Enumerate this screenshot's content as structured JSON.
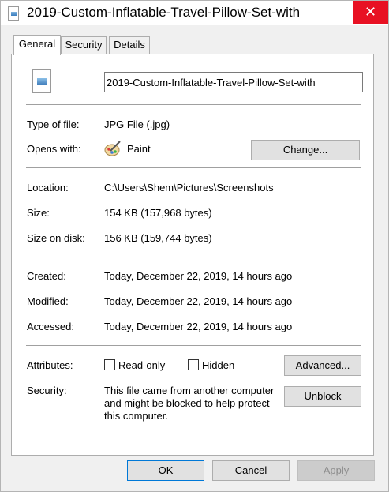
{
  "window": {
    "title": "2019-Custom-Inflatable-Travel-Pillow-Set-with",
    "close_glyph": "✕"
  },
  "tabs": [
    {
      "label": "General",
      "active": true
    },
    {
      "label": "Security",
      "active": false
    },
    {
      "label": "Details",
      "active": false
    }
  ],
  "general": {
    "file_name": "2019-Custom-Inflatable-Travel-Pillow-Set-with",
    "type_label": "Type of file:",
    "type_value": "JPG File (.jpg)",
    "opens_label": "Opens with:",
    "opens_value": "Paint",
    "change_button": "Change...",
    "location_label": "Location:",
    "location_value": "C:\\Users\\Shem\\Pictures\\Screenshots",
    "size_label": "Size:",
    "size_value": "154 KB (157,968 bytes)",
    "size_disk_label": "Size on disk:",
    "size_disk_value": "156 KB (159,744 bytes)",
    "created_label": "Created:",
    "created_value": "Today, December 22, 2019, 14 hours ago",
    "modified_label": "Modified:",
    "modified_value": "Today, December 22, 2019, 14 hours ago",
    "accessed_label": "Accessed:",
    "accessed_value": "Today, December 22, 2019, 14 hours ago",
    "attributes_label": "Attributes:",
    "readonly_label": "Read-only",
    "hidden_label": "Hidden",
    "advanced_button": "Advanced...",
    "security_label": "Security:",
    "security_text": "This file came from another computer and might be blocked to help protect this computer.",
    "unblock_button": "Unblock"
  },
  "footer": {
    "ok": "OK",
    "cancel": "Cancel",
    "apply": "Apply"
  }
}
